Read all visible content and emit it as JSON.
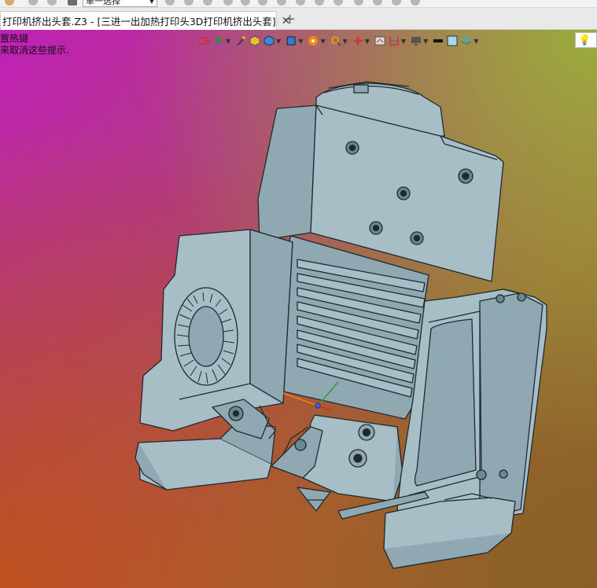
{
  "toolbar": {
    "select_mode": "单一选择"
  },
  "tab": {
    "title": "打印机挤出头套.Z3 - [三进一出加热打印头3D打印机挤出头套]",
    "close_glyph": "✕",
    "new_glyph": "+"
  },
  "viewport": {
    "hint_line1": "置热键",
    "hint_line2": "来取消这些提示."
  },
  "view_toolbar": {
    "icons": [
      "exit-icon",
      "selection-filter-icon",
      "pen-icon",
      "solid-shaded-icon",
      "view-cube-icon",
      "view-orient-icon",
      "render-icon",
      "zoom-icon",
      "origin-icon",
      "section-icon",
      "measure-icon",
      "display-icon",
      "line-style-icon",
      "color-swatch-icon",
      "layers-icon",
      "light-icon"
    ]
  },
  "colors": {
    "model_fill": "#8fa8b2",
    "model_edge": "#1e2a30",
    "model_dark": "#6d8792",
    "model_light": "#a8bec7"
  }
}
